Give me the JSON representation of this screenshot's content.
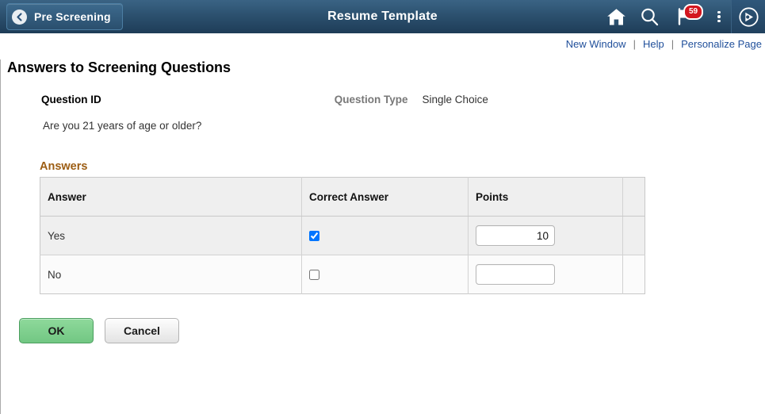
{
  "header": {
    "back_label": "Pre Screening",
    "title": "Resume Template",
    "icons": {
      "home": "home-icon",
      "search": "search-icon",
      "flag": "flag-icon",
      "notification_count": "59",
      "kebab": "more-options-icon",
      "navbar": "navbar-compass-icon"
    }
  },
  "linkbar": {
    "new_window": "New Window",
    "help": "Help",
    "personalize": "Personalize Page",
    "separator": "|"
  },
  "main": {
    "page_title": "Answers to Screening Questions",
    "question_id_label": "Question ID",
    "question_type_label": "Question Type",
    "question_type_value": "Single Choice",
    "question_text": "Are you 21 years of age or older?",
    "answers_heading": "Answers"
  },
  "table": {
    "columns": [
      "Answer",
      "Correct Answer",
      "Points",
      ""
    ],
    "rows": [
      {
        "answer": "Yes",
        "correct": true,
        "points": "10"
      },
      {
        "answer": "No",
        "correct": false,
        "points": ""
      }
    ]
  },
  "buttons": {
    "ok": "OK",
    "cancel": "Cancel"
  },
  "colors": {
    "header_top": "#3a6384",
    "header_bottom": "#1e3c57",
    "link_blue": "#21509b",
    "answers_heading": "#9c5d13",
    "badge_red": "#d3161f",
    "ok_green": "#72c783",
    "row_odd": "#efefef",
    "row_even": "#fbfbfb"
  }
}
